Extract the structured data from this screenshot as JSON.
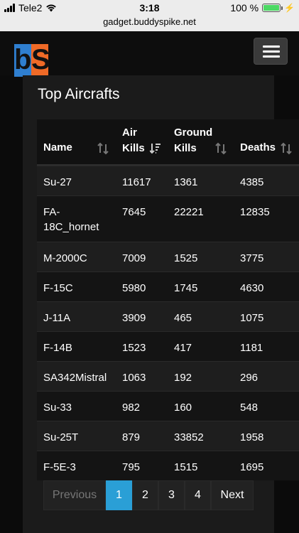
{
  "status_bar": {
    "carrier": "Tele2",
    "time": "3:18",
    "battery": "100 %",
    "battery_level": 1.0
  },
  "browser": {
    "url": "gadget.buddyspike.net"
  },
  "header": {
    "logo_b": "b",
    "logo_s": "S"
  },
  "panel": {
    "title": "Top Aircrafts"
  },
  "table": {
    "columns": [
      {
        "line1": "",
        "line2": "Name"
      },
      {
        "line1": "Air",
        "line2": "Kills"
      },
      {
        "line1": "Ground",
        "line2": "Kills"
      },
      {
        "line1": "",
        "line2": "Deaths"
      }
    ],
    "rows": [
      {
        "name": "Su-27",
        "air": "11617",
        "ground": "1361",
        "deaths": "4385"
      },
      {
        "name": "FA-18C_hornet",
        "air": "7645",
        "ground": "22221",
        "deaths": "12835"
      },
      {
        "name": "M-2000C",
        "air": "7009",
        "ground": "1525",
        "deaths": "3775"
      },
      {
        "name": "F-15C",
        "air": "5980",
        "ground": "1745",
        "deaths": "4630"
      },
      {
        "name": "J-11A",
        "air": "3909",
        "ground": "465",
        "deaths": "1075"
      },
      {
        "name": "F-14B",
        "air": "1523",
        "ground": "417",
        "deaths": "1181"
      },
      {
        "name": "SA342Mistral",
        "air": "1063",
        "ground": "192",
        "deaths": "296"
      },
      {
        "name": "Su-33",
        "air": "982",
        "ground": "160",
        "deaths": "548"
      },
      {
        "name": "Su-25T",
        "air": "879",
        "ground": "33852",
        "deaths": "1958"
      },
      {
        "name": "F-5E-3",
        "air": "795",
        "ground": "1515",
        "deaths": "1695"
      }
    ]
  },
  "pagination": {
    "previous": "Previous",
    "pages": [
      "1",
      "2",
      "3",
      "4"
    ],
    "next": "Next",
    "active": "1"
  },
  "colors": {
    "accent": "#2a9fd6",
    "logo_blue": "#2f7fd0",
    "logo_orange": "#ef6a27",
    "battery_green": "#4cd964"
  }
}
